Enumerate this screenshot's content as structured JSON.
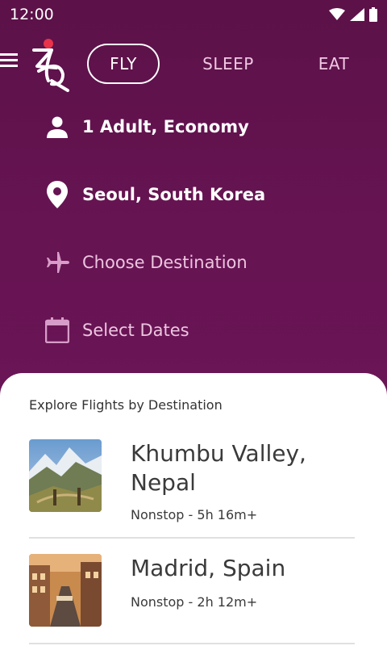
{
  "status_bar": {
    "time": "12:00",
    "icons": [
      "wifi-icon",
      "signal-icon",
      "battery-icon"
    ]
  },
  "nav": {
    "menu_icon": "menu-icon",
    "logo": "brand-logo-icon",
    "tabs": [
      {
        "label": "FLY",
        "active": true
      },
      {
        "label": "SLEEP",
        "active": false
      },
      {
        "label": "EAT",
        "active": false
      }
    ]
  },
  "search": {
    "traveler": {
      "icon": "person-icon",
      "value": "1 Adult, Economy"
    },
    "origin": {
      "icon": "location-pin-icon",
      "value": "Seoul, South Korea"
    },
    "destination": {
      "icon": "airplane-icon",
      "placeholder": "Choose Destination"
    },
    "dates": {
      "icon": "calendar-icon",
      "placeholder": "Select Dates"
    }
  },
  "explore": {
    "title": "Explore Flights by Destination",
    "destinations": [
      {
        "name": "Khumbu Valley, Nepal",
        "meta": "Nonstop - 5h 16m+",
        "image": "mountain-valley-photo"
      },
      {
        "name": "Madrid, Spain",
        "meta": "Nonstop - 2h 12m+",
        "image": "city-street-photo"
      }
    ]
  },
  "colors": {
    "primary": "#661452",
    "surface": "#ffffff",
    "text_on_primary": "#ffffff",
    "text_dark": "#3a3a3a"
  }
}
